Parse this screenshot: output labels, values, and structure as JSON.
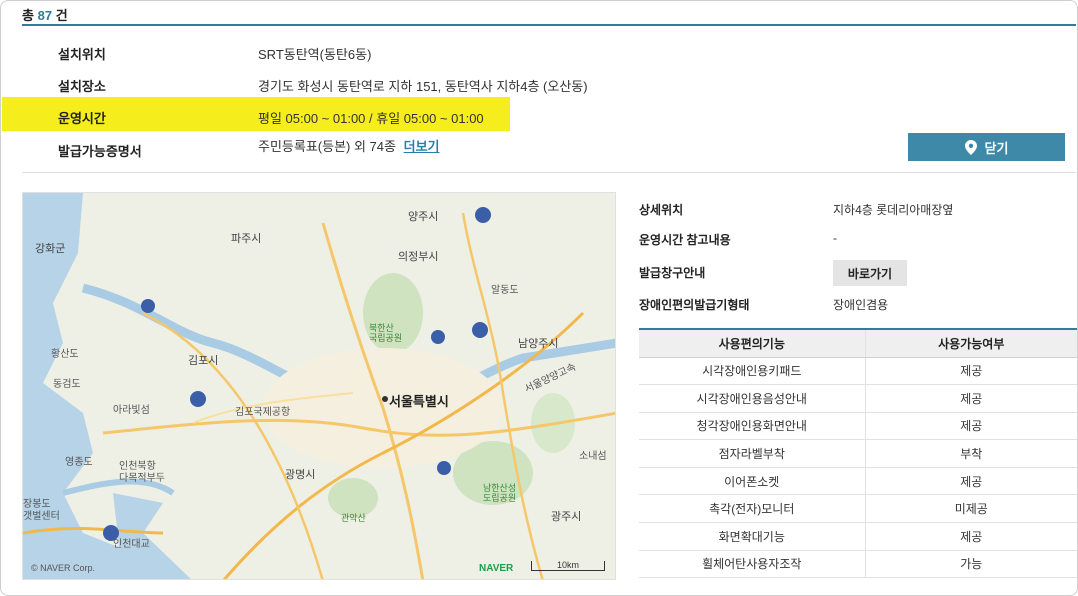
{
  "header": {
    "total_prefix": "총",
    "total_count": "87",
    "total_suffix": "건"
  },
  "info": {
    "location_label": "설치위치",
    "location_value": "SRT동탄역(동탄6동)",
    "place_label": "설치장소",
    "place_value": "경기도 화성시 동탄역로 지하 151, 동탄역사 지하4층 (오산동)",
    "hours_label": "운영시간",
    "hours_value": "평일 05:00 ~ 01:00 / 휴일 05:00 ~ 01:00",
    "certs_label": "발급가능증명서",
    "certs_value": "주민등록표(등본) 외 74종",
    "more_link": "더보기"
  },
  "close_button": {
    "label": "닫기",
    "icon": "location-pin-icon"
  },
  "map": {
    "labels": {
      "yangju": "양주시",
      "ganghwa": "강화군",
      "paju": "파주시",
      "uijeongbu": "의정부시",
      "namyangju": "남양주시",
      "gimpo": "김포시",
      "seoul": "서울특별시",
      "hwangsan": "황산도",
      "donggeom": "동검도",
      "yeongjong": "영종도",
      "gwangmyeong": "광명시",
      "gwangju": "광주시",
      "soraesan": "소내섬",
      "bukhansan": "북한산\n국립공원",
      "namhansanseong": "남한산성\n도립공원",
      "gwanaksan": "관악산",
      "gimpo_airport": "김포국제공항",
      "incheon_bridge": "인천대교",
      "seouldong": "서울양양고속",
      "albong": "알동도",
      "ara": "아라빛섬",
      "incheon_bukhang": "인천북항\n다목적부두",
      "jangbong": "장봉도\n갯벌센터"
    },
    "copyright": "© NAVER Corp.",
    "brand": "NAVER",
    "scale": "10km"
  },
  "detail": {
    "detail_loc_label": "상세위치",
    "detail_loc_value": "지하4층 롯데리아매장옆",
    "hours_note_label": "운영시간 참고내용",
    "hours_note_value": "-",
    "window_label": "발급창구안내",
    "window_button": "바로가기",
    "disabled_label": "장애인편의발급기형태",
    "disabled_value": "장애인겸용"
  },
  "features": {
    "headers": [
      "사용편의기능",
      "사용가능여부"
    ],
    "rows": [
      [
        "시각장애인용키패드",
        "제공"
      ],
      [
        "시각장애인용음성안내",
        "제공"
      ],
      [
        "청각장애인용화면안내",
        "제공"
      ],
      [
        "점자라벨부착",
        "부착"
      ],
      [
        "이어폰소켓",
        "제공"
      ],
      [
        "촉각(전자)모니터",
        "미제공"
      ],
      [
        "화면확대기능",
        "제공"
      ],
      [
        "휠체어탄사용자조작",
        "가능"
      ]
    ]
  },
  "colors": {
    "accent": "#2e7d9a",
    "highlight": "#f6ee1c",
    "button": "#3e89a7"
  }
}
